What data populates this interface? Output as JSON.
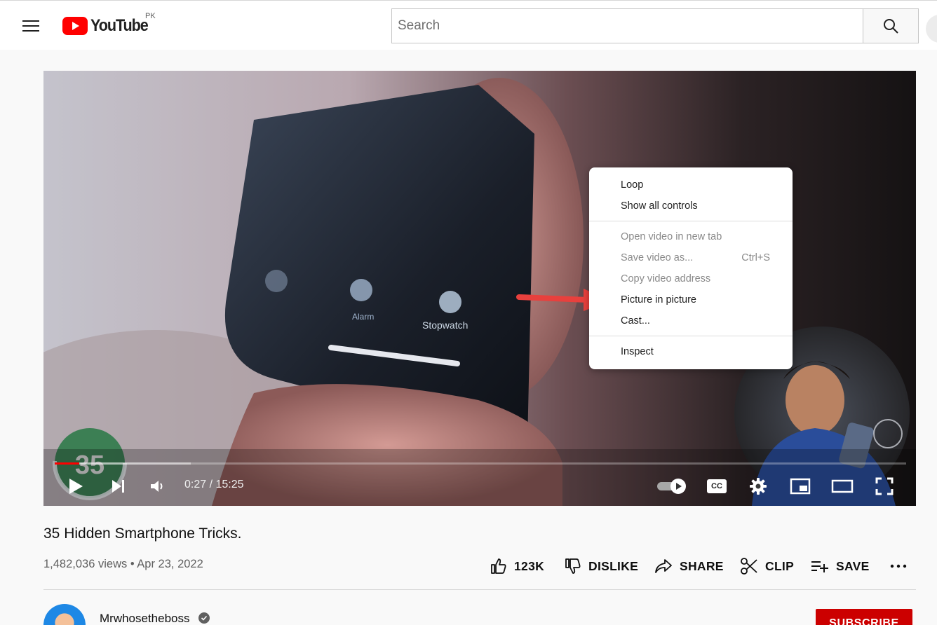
{
  "header": {
    "logo_text": "YouTube",
    "region_code": "PK",
    "search_placeholder": "Search"
  },
  "player": {
    "time_display": "0:27 / 15:25",
    "played_fraction": 0.029,
    "buffered_fraction": 0.16,
    "controls": {
      "play_icon": "play-icon",
      "next_icon": "next-icon",
      "volume_icon": "volume-icon",
      "autoplay_icon": "autoplay-toggle-icon",
      "captions_label": "CC",
      "settings_icon": "gear-icon",
      "miniplayer_icon": "miniplayer-icon",
      "theater_icon": "theater-icon",
      "fullscreen_icon": "fullscreen-icon"
    },
    "overlay": {
      "badge_number": "35",
      "phone_labels": [
        "Alarm",
        "Stopwatch"
      ]
    }
  },
  "context_menu": {
    "items": [
      {
        "label": "Loop",
        "enabled": true
      },
      {
        "label": "Show all controls",
        "enabled": true
      },
      {
        "label": "Open video in new tab",
        "enabled": false
      },
      {
        "label": "Save video as...",
        "shortcut": "Ctrl+S",
        "enabled": false
      },
      {
        "label": "Copy video address",
        "enabled": false
      },
      {
        "label": "Picture in picture",
        "enabled": true
      },
      {
        "label": "Cast...",
        "enabled": true
      },
      {
        "label": "Inspect",
        "enabled": true
      }
    ]
  },
  "annotation": {
    "arrow_color": "#e8403d",
    "points_to": "Picture in picture"
  },
  "video": {
    "title": "35 Hidden Smartphone Tricks.",
    "meta": "1,482,036 views • Apr 23, 2022"
  },
  "actions": {
    "like": "123K",
    "dislike": "DISLIKE",
    "share": "SHARE",
    "clip": "CLIP",
    "save": "SAVE"
  },
  "channel": {
    "name": "Mrwhosetheboss",
    "subscribe_label": "SUBSCRIBE"
  },
  "colors": {
    "brand_red": "#ff0000",
    "subscribe_red": "#cc0000",
    "page_bg": "#f9f9f9"
  }
}
